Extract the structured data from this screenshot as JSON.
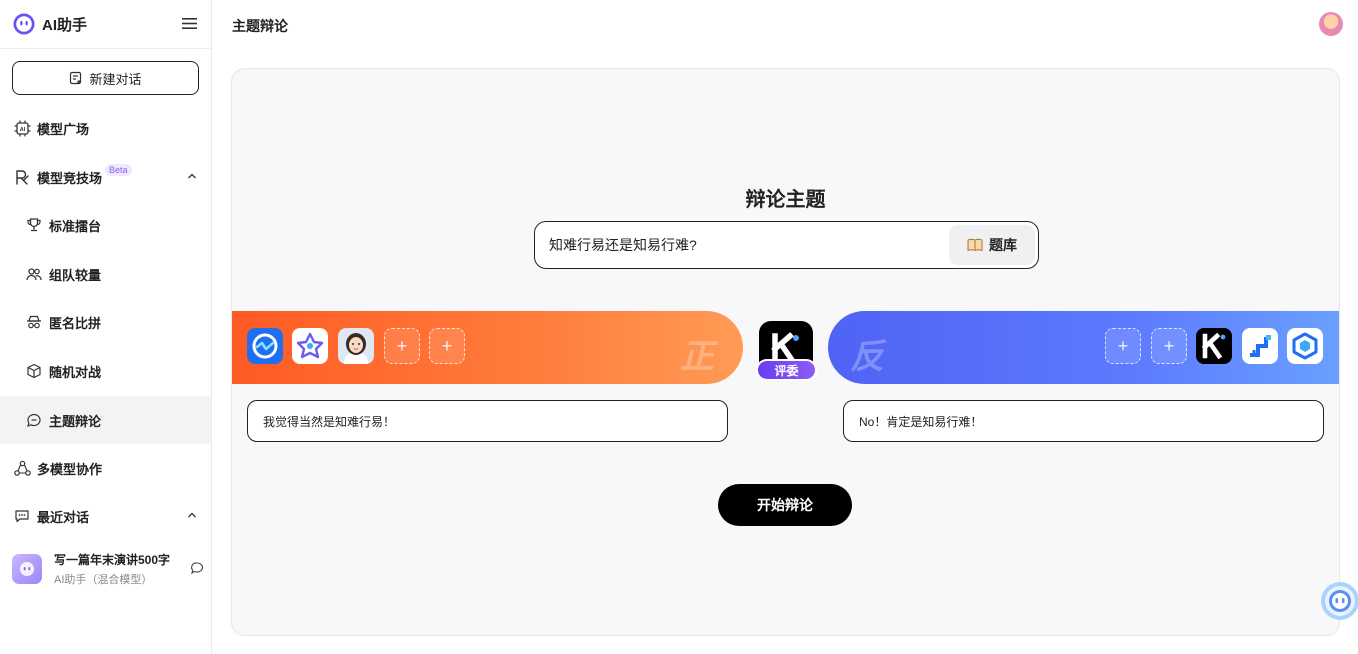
{
  "sidebar": {
    "brand": "AI助手",
    "new_chat": "新建对话",
    "items": [
      {
        "label": "模型广场"
      },
      {
        "label": "模型竞技场",
        "badge": "Beta"
      },
      {
        "label": "标准擂台"
      },
      {
        "label": "组队较量"
      },
      {
        "label": "匿名比拼"
      },
      {
        "label": "随机对战"
      },
      {
        "label": "主题辩论"
      },
      {
        "label": "多模型协作"
      },
      {
        "label": "最近对话"
      }
    ],
    "recent": {
      "title": "写一篇年末演讲500字",
      "subtitle": "AI助手（混合模型）"
    }
  },
  "header": {
    "title": "主题辩论"
  },
  "debate": {
    "heading": "辩论主题",
    "topic_value": "知难行易还是知易行难?",
    "topic_bank": "题库",
    "pro_label": "正",
    "con_label": "反",
    "judge_label": "评委",
    "pro_stance": "我觉得当然是知难行易！",
    "con_stance": "No！肯定是知易行难！",
    "start_button": "开始辩论"
  },
  "colors": {
    "pro_gradient": [
      "#ff5a24",
      "#ff9b55"
    ],
    "con_gradient": [
      "#4f63f5",
      "#6aa0ff"
    ],
    "judge_badge": "#7c4df2",
    "primary_button": "#000000"
  },
  "icons": {
    "pro_models": [
      "blue-ring-model-icon",
      "purple-star-model-icon",
      "girl-avatar-model-icon",
      "add-slot-icon",
      "add-slot-icon"
    ],
    "con_models": [
      "add-slot-icon",
      "add-slot-icon",
      "k-logo-model-icon",
      "step-logo-model-icon",
      "cube-logo-model-icon"
    ]
  }
}
